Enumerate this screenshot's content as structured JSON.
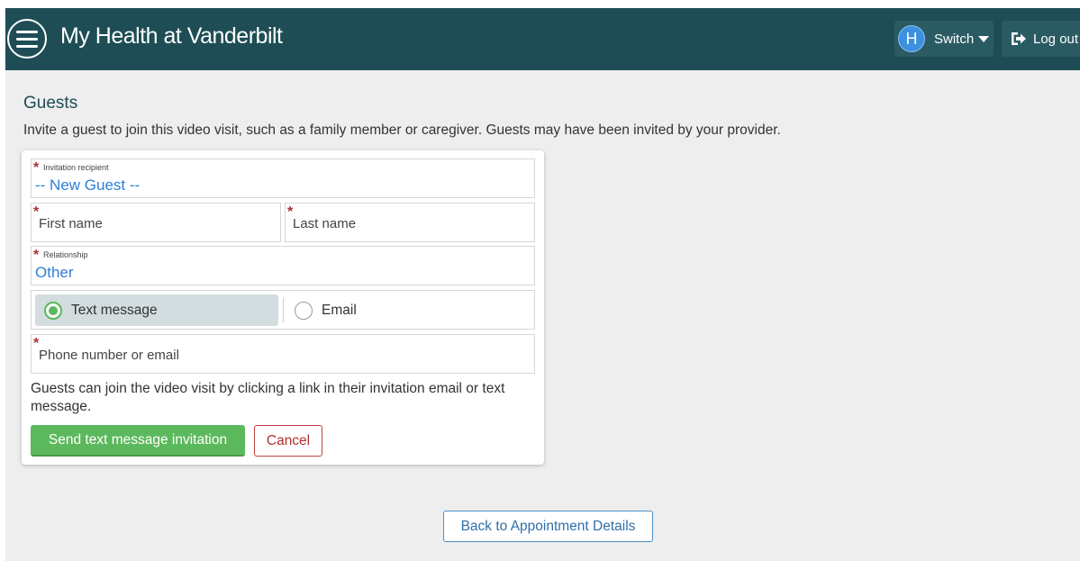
{
  "header": {
    "title": "My Health at Vanderbilt",
    "avatar_initial": "H",
    "switch_label": "Switch",
    "logout_label": "Log out",
    "bg_color": "#1e4d55"
  },
  "page": {
    "heading": "Guests",
    "description": "Invite a guest to join this video visit, such as a family member or caregiver. Guests may have been invited by your provider."
  },
  "form": {
    "required_mark": "*",
    "recipient": {
      "label": "Invitation recipient",
      "value": "-- New Guest --"
    },
    "first_name": {
      "placeholder": "First name"
    },
    "last_name": {
      "placeholder": "Last name"
    },
    "relationship": {
      "label": "Relationship",
      "value": "Other"
    },
    "method": {
      "options": [
        {
          "label": "Text message",
          "selected": true
        },
        {
          "label": "Email",
          "selected": false
        }
      ]
    },
    "contact": {
      "placeholder": "Phone number or email"
    },
    "help_text": "Guests can join the video visit by clicking a link in their invitation email or text message.",
    "send_label": "Send text message invitation",
    "cancel_label": "Cancel"
  },
  "footer": {
    "back_label": "Back to Appointment Details"
  },
  "colors": {
    "accent_green": "#5cb85c",
    "link_blue": "#2f7ed8",
    "required_red": "#b03030"
  }
}
